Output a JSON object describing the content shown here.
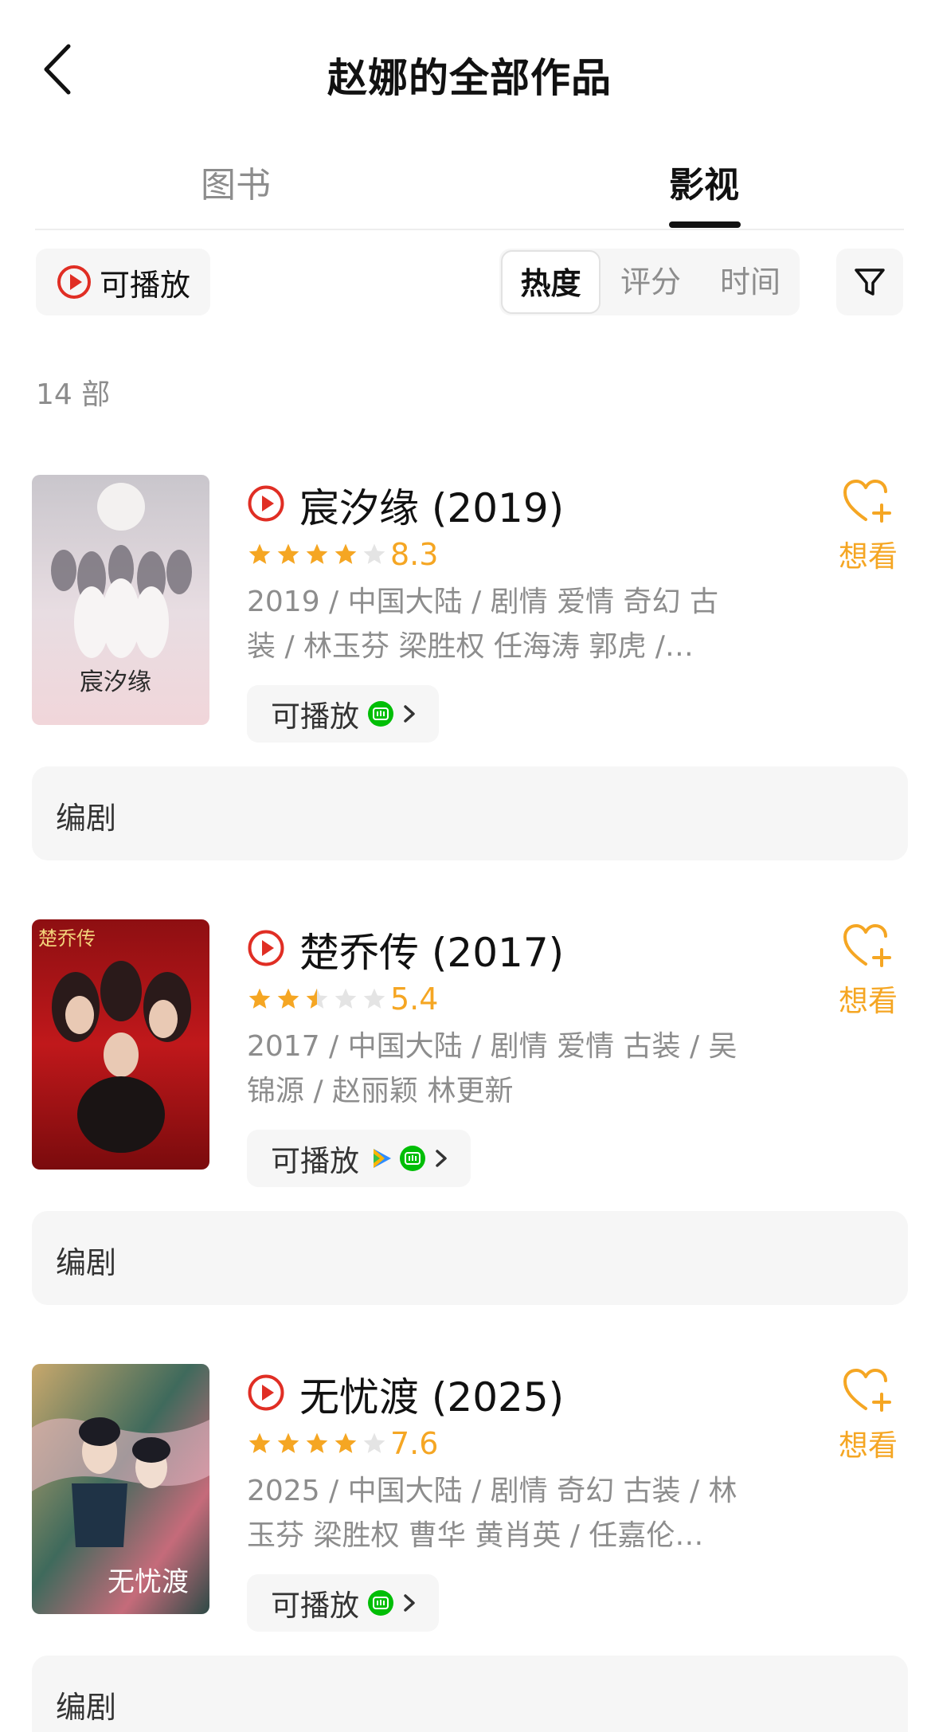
{
  "header": {
    "title": "赵娜的全部作品"
  },
  "tabs": [
    {
      "label": "图书"
    },
    {
      "label": "影视"
    }
  ],
  "filters": {
    "playable": "可播放",
    "sort": [
      "热度",
      "评分",
      "时间"
    ]
  },
  "count": "14 部",
  "colors": {
    "accent": "#f5a623",
    "play_red": "#e02e24",
    "iqiyi_green": "#00be06",
    "tencent_blue": "#2f8cff"
  },
  "items": [
    {
      "title": "宸汐缘 (2019)",
      "rating": "8.3",
      "stars": 4,
      "meta_line1": "2019 / 中国大陆 / 剧情 爱情 奇幻 古",
      "meta_line2": "装 / 林玉芬 梁胜权 任海涛 郭虎 /…",
      "playable": "可播放",
      "sources": [
        "iqiyi-icon"
      ],
      "want": "想看",
      "role": "编剧"
    },
    {
      "title": "楚乔传 (2017)",
      "rating": "5.4",
      "stars": 2.5,
      "meta_line1": "2017 / 中国大陆 / 剧情 爱情 古装 / 吴",
      "meta_line2": "锦源 / 赵丽颖 林更新",
      "playable": "可播放",
      "sources": [
        "tencent-video-icon",
        "iqiyi-icon"
      ],
      "want": "想看",
      "role": "编剧"
    },
    {
      "title": "无忧渡 (2025)",
      "rating": "7.6",
      "stars": 4,
      "meta_line1": "2025 / 中国大陆 / 剧情 奇幻 古装 / 林",
      "meta_line2": "玉芬 梁胜权 曹华 黄肖英 / 任嘉伦…",
      "playable": "可播放",
      "sources": [
        "iqiyi-icon"
      ],
      "want": "想看",
      "role": "编剧"
    }
  ]
}
